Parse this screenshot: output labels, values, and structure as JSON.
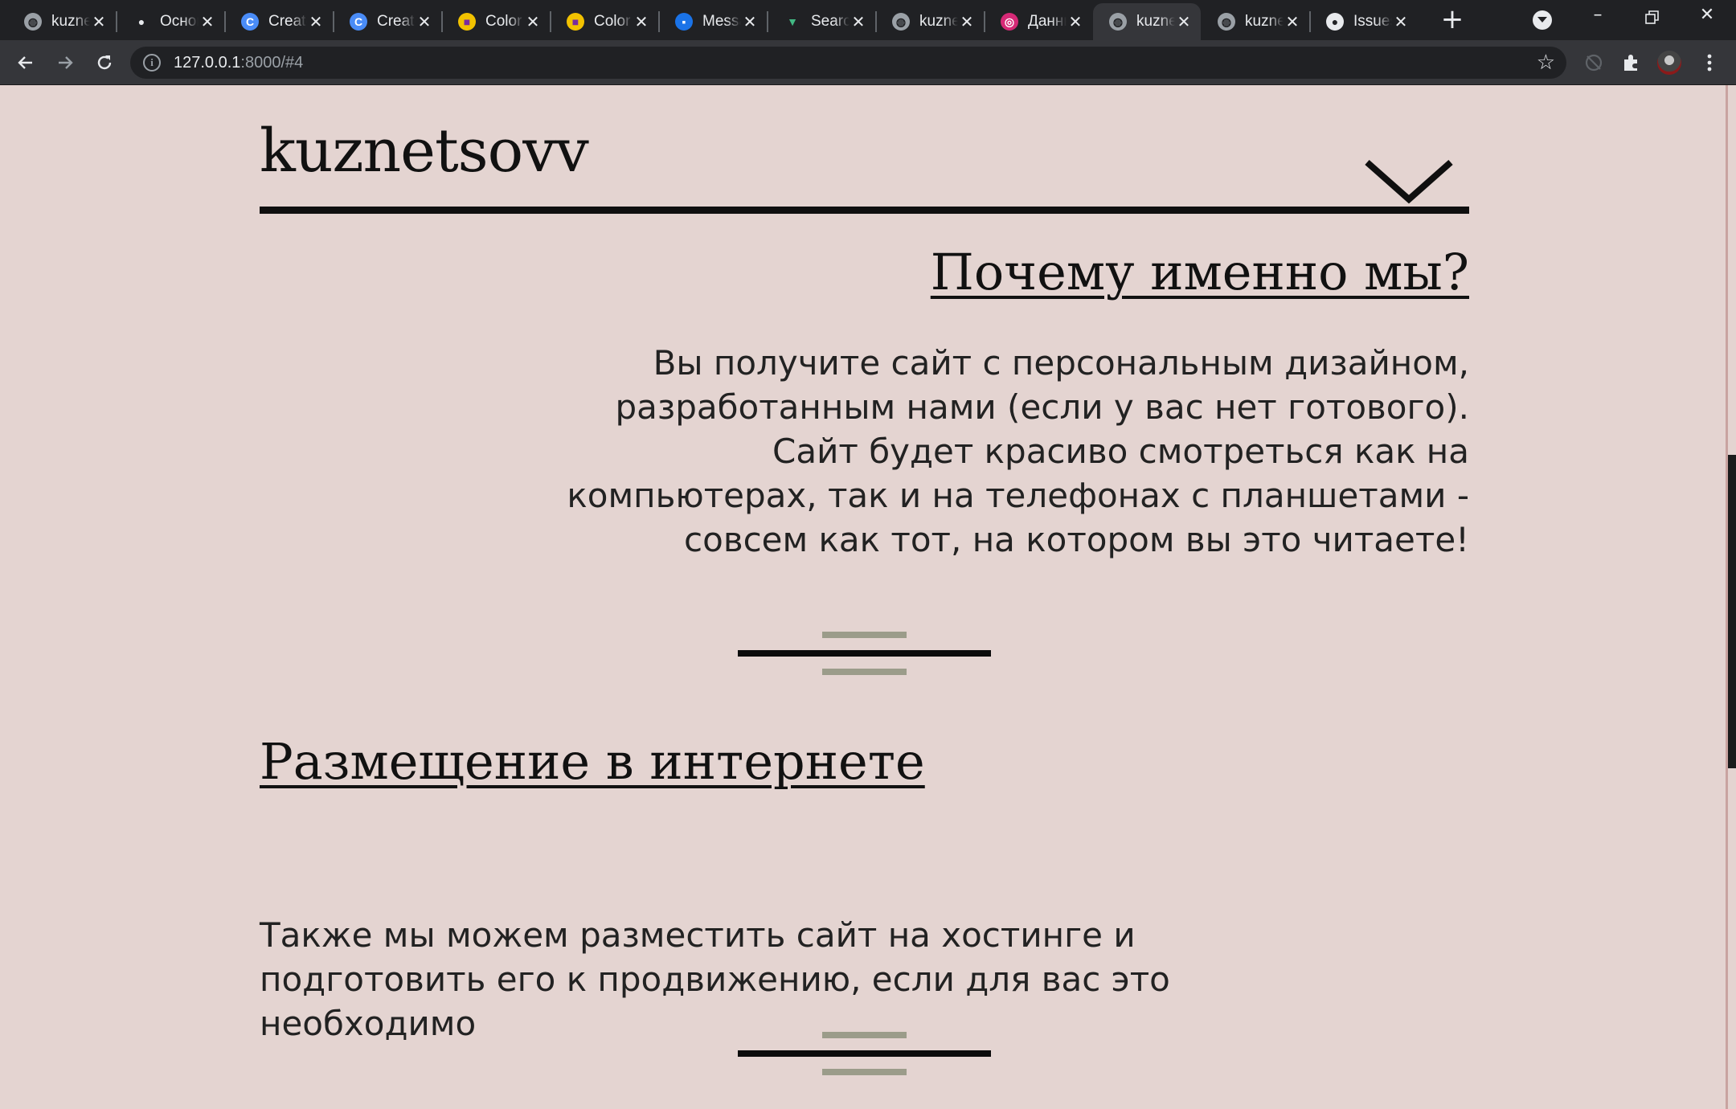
{
  "browser": {
    "tabs": [
      {
        "title": "kuznetsovv",
        "icon": "globe-icon",
        "active": false
      },
      {
        "title": "Основы",
        "icon": "parrot-icon",
        "active": false
      },
      {
        "title": "Create",
        "icon": "c-logo-icon",
        "active": false
      },
      {
        "title": "Create",
        "icon": "c-logo-icon",
        "active": false
      },
      {
        "title": "Color",
        "icon": "color-icon",
        "active": false
      },
      {
        "title": "Color",
        "icon": "color-icon",
        "active": false
      },
      {
        "title": "Messages",
        "icon": "messages-icon",
        "active": false
      },
      {
        "title": "Search",
        "icon": "vue-icon",
        "active": false
      },
      {
        "title": "kuznetsovv",
        "icon": "globe-icon",
        "active": false
      },
      {
        "title": "Данные",
        "icon": "instagram-icon",
        "active": false
      },
      {
        "title": "kuznetsovv",
        "icon": "globe-icon",
        "active": true
      },
      {
        "title": "kuznetsovv",
        "icon": "globe-icon",
        "active": false
      },
      {
        "title": "Issues",
        "icon": "github-icon",
        "active": false
      }
    ],
    "url_host": "127.0.0.1",
    "url_rest": ":8000/#4",
    "accent": "#35363a"
  },
  "site": {
    "logo": "kuznetsovv",
    "section1": {
      "title": "Почему именно мы?",
      "lines": [
        "Вы получите сайт с персональным дизайном,",
        "разработанным нами (если у вас нет готового).",
        "Сайт будет красиво смотреться как на",
        "компьютерах, так и на телефонах с планшетами -",
        "совсем как тот, на котором вы это читаете!"
      ]
    },
    "section2": {
      "title": "Размещение в интернете",
      "lines": [
        "Также мы можем разместить сайт на хостинге и",
        "подготовить его к продвижению, если для вас это",
        "необходимо"
      ]
    },
    "colors": {
      "background": "#e4d4d1",
      "text": "#111111",
      "divider_accent": "#9b9c8a"
    }
  }
}
